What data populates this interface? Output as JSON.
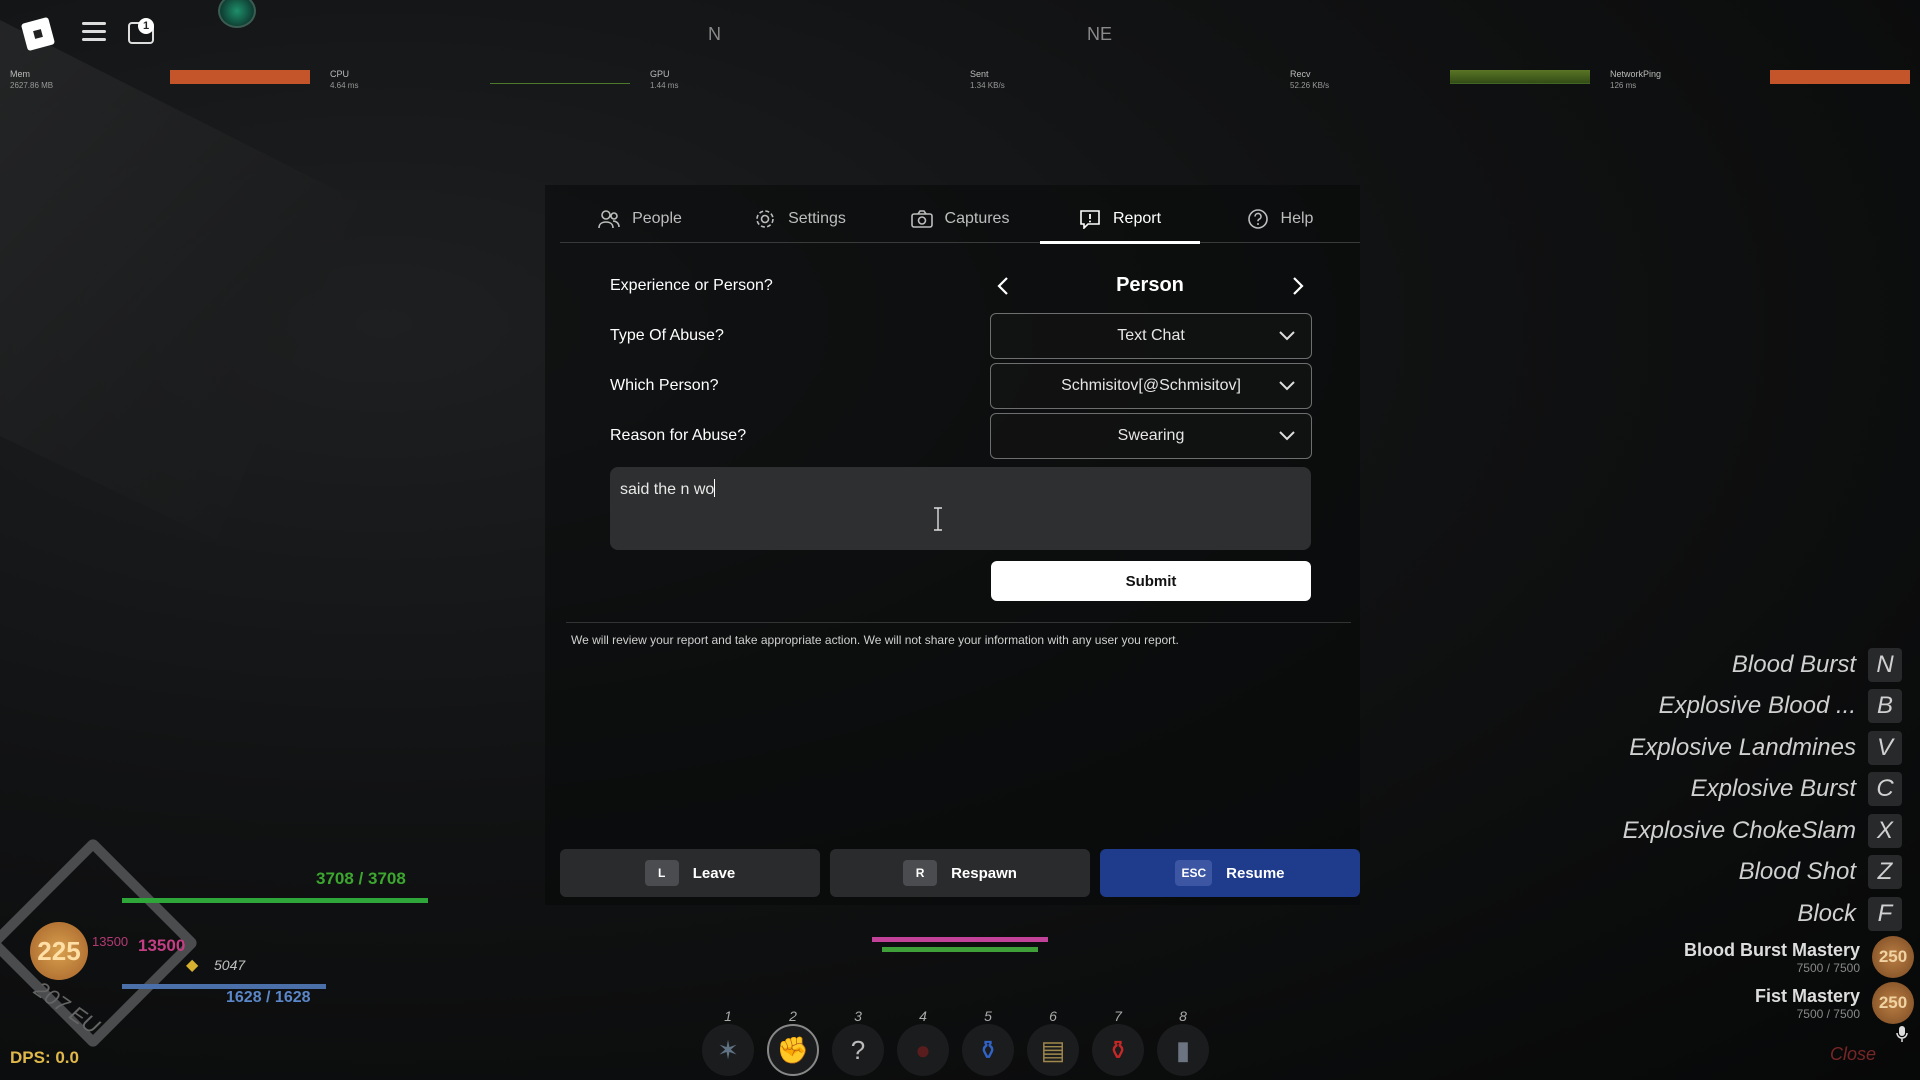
{
  "topbar": {
    "chat_badge": "1",
    "compass": [
      "N",
      "NE"
    ],
    "stats": [
      {
        "label": "Mem",
        "value": "2627.86 MB"
      },
      {
        "label": "CPU",
        "value": "4.64 ms"
      },
      {
        "label": "GPU",
        "value": "1.44 ms"
      },
      {
        "label": "Sent",
        "value": "1.34 KB/s"
      },
      {
        "label": "Recv",
        "value": "52.26 KB/s"
      },
      {
        "label": "NetworkPing",
        "value": "126 ms"
      }
    ]
  },
  "tabs": [
    {
      "label": "People",
      "icon": "people-icon"
    },
    {
      "label": "Settings",
      "icon": "gear-icon"
    },
    {
      "label": "Captures",
      "icon": "camera-icon"
    },
    {
      "label": "Report",
      "icon": "report-icon",
      "active": true
    },
    {
      "label": "Help",
      "icon": "help-icon"
    }
  ],
  "report": {
    "experience_label": "Experience or Person?",
    "experience_value": "Person",
    "abuse_type_label": "Type Of Abuse?",
    "abuse_type_value": "Text Chat",
    "person_label": "Which Person?",
    "person_value": "Schmisitov[@Schmisitov]",
    "reason_label": "Reason for Abuse?",
    "reason_value": "Swearing",
    "description_value": "said the n wo",
    "submit_label": "Submit",
    "disclaimer": "We will review your report and take appropriate action. We will not share your information with any user you report."
  },
  "bottom_buttons": [
    {
      "key": "L",
      "label": "Leave"
    },
    {
      "key": "R",
      "label": "Respawn"
    },
    {
      "key": "ESC",
      "label": "Resume"
    }
  ],
  "hud": {
    "level": "225",
    "hp": "3708 / 3708",
    "xp_small": "13500",
    "xp_big": "13500",
    "gold": "5047",
    "mp": "1628 / 1628",
    "region": "207 EU",
    "dps": "DPS: 0.0"
  },
  "hotbar": [
    "1",
    "2",
    "3",
    "4",
    "5",
    "6",
    "7",
    "8"
  ],
  "skills": [
    {
      "name": "Blood Burst",
      "key": "N"
    },
    {
      "name": "Explosive Blood ...",
      "key": "B"
    },
    {
      "name": "Explosive Landmines",
      "key": "V"
    },
    {
      "name": "Explosive Burst",
      "key": "C"
    },
    {
      "name": "Explosive ChokeSlam",
      "key": "X"
    },
    {
      "name": "Blood Shot",
      "key": "Z"
    },
    {
      "name": "Block",
      "key": "F"
    }
  ],
  "masteries": [
    {
      "name": "Blood Burst Mastery",
      "value": "7500 / 7500",
      "badge": "250"
    },
    {
      "name": "Fist Mastery",
      "value": "7500 / 7500",
      "badge": "250"
    }
  ],
  "close_label": "Close",
  "colors": {
    "accent_resume": "#1e3b8c",
    "hp": "#3ca72f",
    "mp": "#5b86c8",
    "xp": "#c43e84",
    "perf_bar": "#c4542a"
  }
}
